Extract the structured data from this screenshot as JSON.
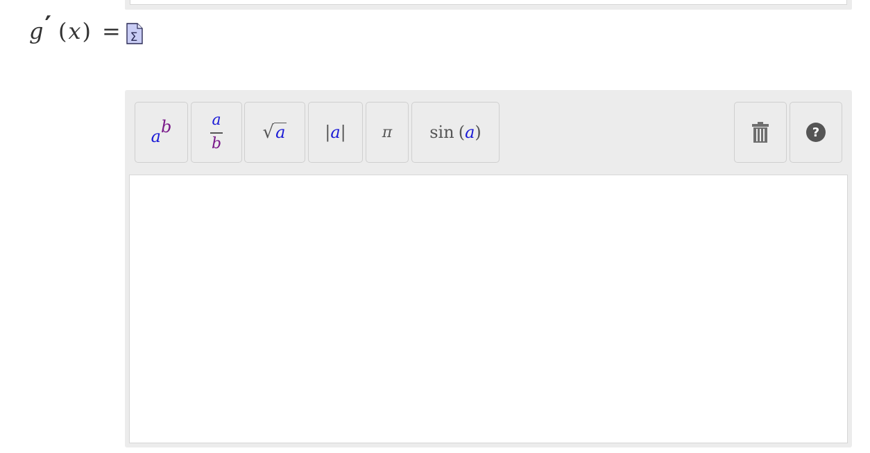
{
  "formula": {
    "func": "g",
    "prime": "′",
    "open_paren": "(",
    "var": "x",
    "close_paren": ")",
    "equals": "="
  },
  "toolbar": {
    "power": {
      "base": "a",
      "exponent": "b"
    },
    "fraction": {
      "numerator": "a",
      "denominator": "b"
    },
    "sqrt": {
      "symbol": "√",
      "radicand": "a"
    },
    "abs": {
      "left": "|",
      "inner": "a",
      "right": "|"
    },
    "pi": "π",
    "sin": {
      "fn": "sin",
      "open": "(",
      "arg": "a",
      "close": ")"
    }
  },
  "icons": {
    "sigma": "sigma-icon",
    "trash": "trash-icon",
    "help": "help-icon"
  },
  "colors": {
    "blue_var": "#1a1ad6",
    "purple_var": "#7a1a8a",
    "panel_bg": "#ececec",
    "icon_grey": "#6e6e6e"
  },
  "answer": {
    "value": ""
  }
}
